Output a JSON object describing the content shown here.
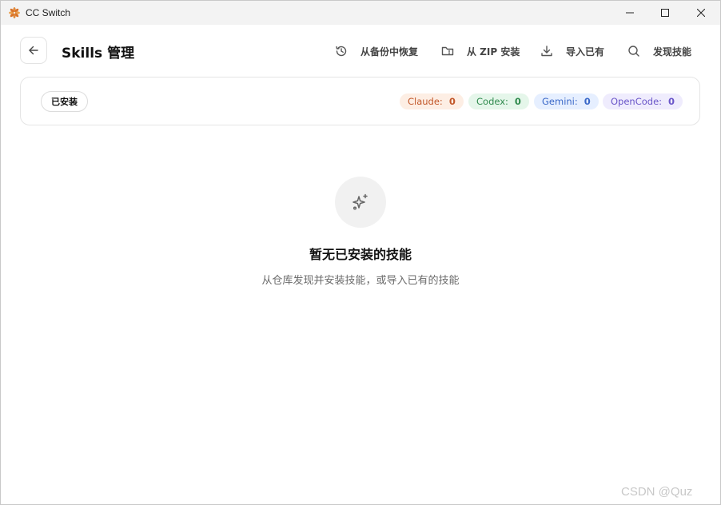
{
  "window": {
    "title": "CC Switch"
  },
  "header": {
    "title": "Skills 管理",
    "actions": [
      {
        "label": "从备份中恢复",
        "icon": "history-icon"
      },
      {
        "label": "从 ZIP 安装",
        "icon": "folder-zip-icon"
      },
      {
        "label": "导入已有",
        "icon": "download-icon"
      },
      {
        "label": "发现技能",
        "icon": "search-icon"
      }
    ]
  },
  "filters": {
    "installed_label": "已安装",
    "counts": [
      {
        "label": "Claude:",
        "count": "0",
        "color": "#c2572a"
      },
      {
        "label": "Codex:",
        "count": "0",
        "color": "#2f8a4d"
      },
      {
        "label": "Gemini:",
        "count": "0",
        "color": "#3a68c8"
      },
      {
        "label": "OpenCode:",
        "count": "0",
        "color": "#6a56c9"
      }
    ]
  },
  "empty_state": {
    "icon": "sparkles-icon",
    "title": "暂无已安装的技能",
    "subtitle": "从仓库发现并安装技能，或导入已有的技能"
  },
  "watermark": "CSDN @Quz"
}
